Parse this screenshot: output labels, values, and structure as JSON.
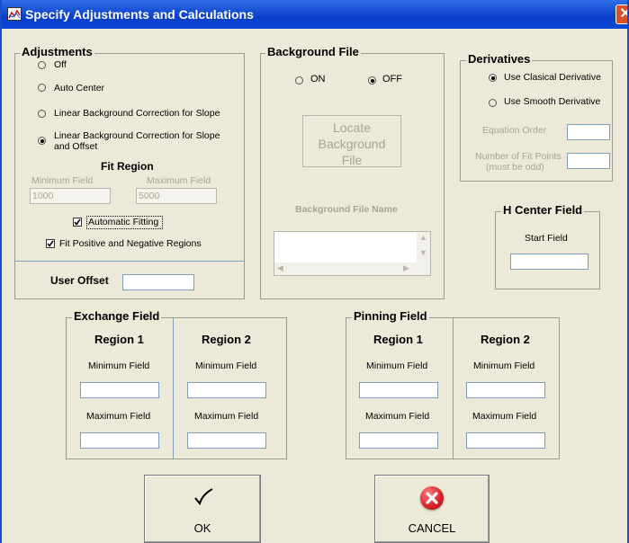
{
  "window": {
    "title": "Specify Adjustments and Calculations",
    "close_glyph": "✕"
  },
  "adjustments": {
    "legend": "Adjustments",
    "options": [
      "Off",
      "Auto Center",
      "Linear Background Correction for Slope",
      "Linear Background Correction for Slope",
      "and Offset"
    ],
    "selected_index": 3,
    "fit_region": {
      "title": "Fit Region",
      "min_label": "Minimum Field",
      "max_label": "Maximum Field",
      "min_value": "1000",
      "max_value": "5000"
    },
    "automatic_fitting": {
      "label": "Automatic Fitting",
      "checked": true
    },
    "fit_pos_neg": {
      "label": "Fit Positive and Negative Regions",
      "checked": true
    },
    "user_offset_label": "User Offset",
    "user_offset_value": ""
  },
  "background_file": {
    "legend": "Background File",
    "on_label": "ON",
    "off_label": "OFF",
    "selected": "OFF",
    "locate_button": [
      "Locate",
      "Background",
      "File"
    ],
    "file_name_label": "Background File Name",
    "file_name_value": ""
  },
  "derivatives": {
    "legend": "Derivatives",
    "options": [
      "Use Clasical Derivative",
      "Use Smooth Derivative"
    ],
    "selected_index": 0,
    "equation_order_label": "Equation Order",
    "fit_points_label": [
      "Number of Fit Points",
      "(must be odd)"
    ]
  },
  "h_center": {
    "legend": "H Center Field",
    "start_label": "Start Field",
    "start_value": ""
  },
  "exchange_field": {
    "legend": "Exchange Field",
    "regions": [
      {
        "title": "Region 1",
        "min_label": "Minimum Field",
        "max_label": "Maximum Field"
      },
      {
        "title": "Region 2",
        "min_label": "Minimum Field",
        "max_label": "Maximum Field"
      }
    ]
  },
  "pinning_field": {
    "legend": "Pinning Field",
    "regions": [
      {
        "title": "Region 1",
        "min_label": "Minimum Field",
        "max_label": "Maximum Field"
      },
      {
        "title": "Region 2",
        "min_label": "Minimum Field",
        "max_label": "Maximum Field"
      }
    ]
  },
  "buttons": {
    "ok_label": "OK",
    "cancel_label": "CANCEL",
    "ok_glyph": "✓",
    "cancel_glyph": "✕"
  },
  "colors": {
    "titlebar": "#0a3fc7",
    "dialog_bg": "#ECE9D8",
    "close": "#d9502a",
    "cancel_icon": "#d8202a"
  }
}
